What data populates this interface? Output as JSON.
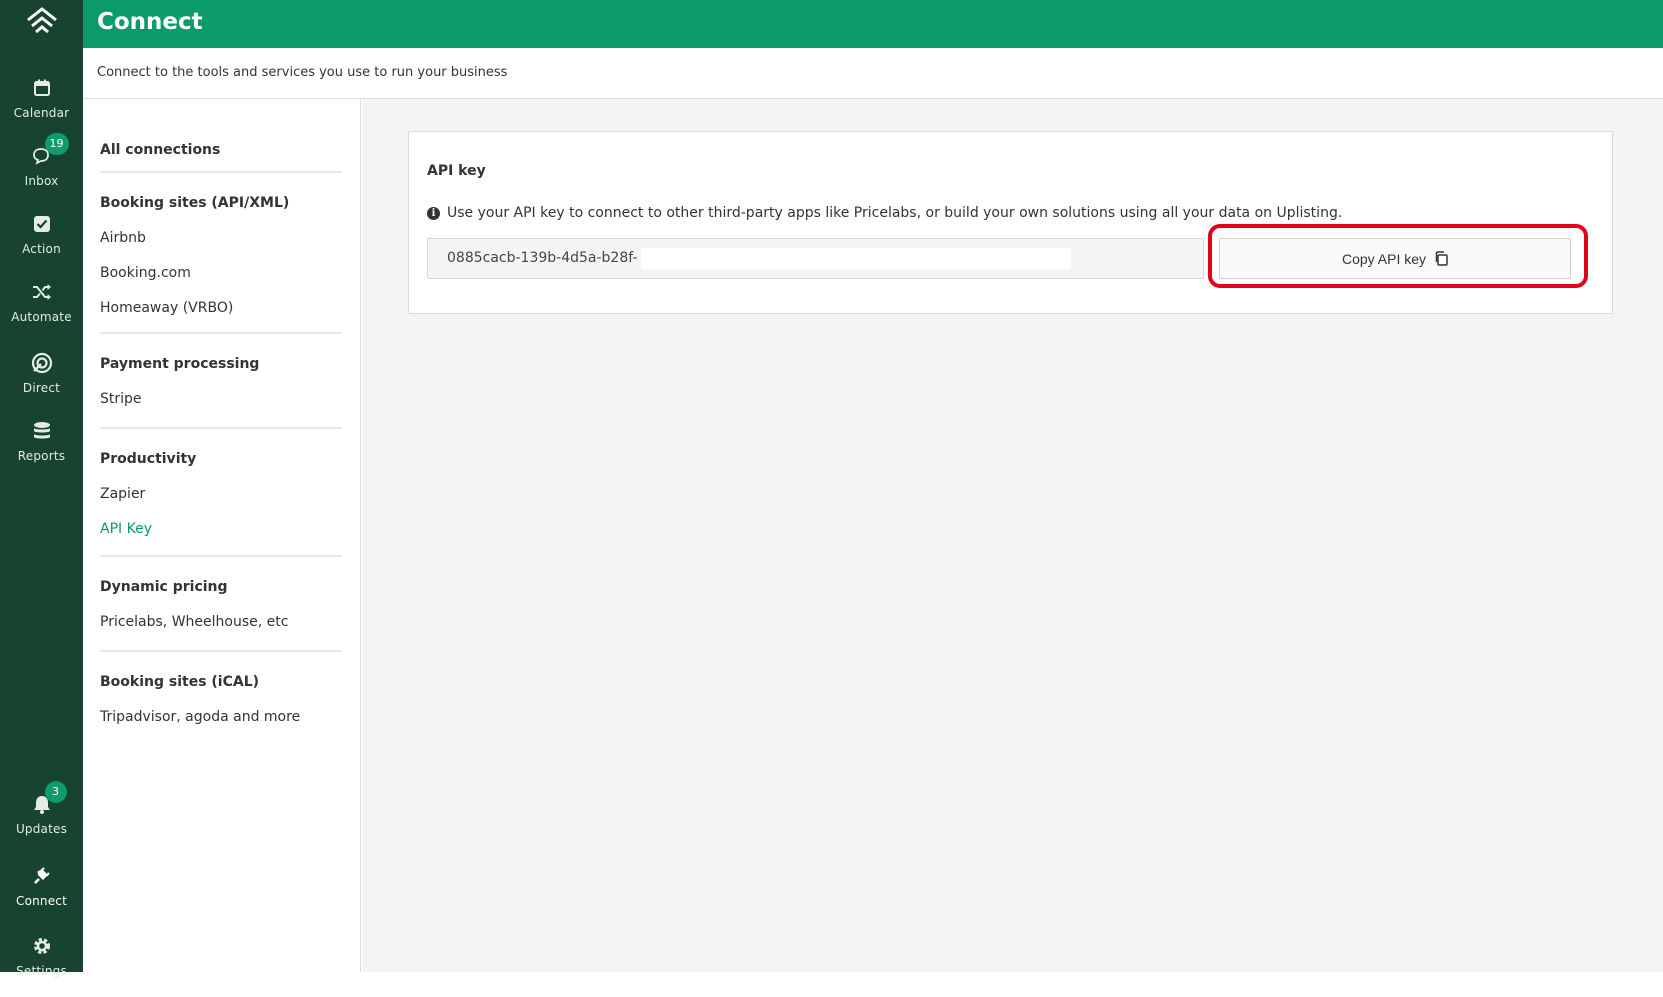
{
  "header": {
    "title": "Connect",
    "subtitle": "Connect to the tools and services you use to run your business"
  },
  "rail": {
    "items": [
      {
        "label": "Calendar",
        "icon": "calendar-icon"
      },
      {
        "label": "Inbox",
        "icon": "chat-icon",
        "badge": "19"
      },
      {
        "label": "Action",
        "icon": "checkbox-icon"
      },
      {
        "label": "Automate",
        "icon": "shuffle-icon"
      },
      {
        "label": "Direct",
        "icon": "direct-icon"
      },
      {
        "label": "Reports",
        "icon": "database-icon"
      },
      {
        "label": "Updates",
        "icon": "bell-icon",
        "badge": "3"
      },
      {
        "label": "Connect",
        "icon": "plug-icon",
        "active": true
      },
      {
        "label": "Settings",
        "icon": "gear-icon"
      }
    ]
  },
  "nav": {
    "all_connections": "All connections",
    "groups": [
      {
        "title": "Booking sites (API/XML)",
        "items": [
          "Airbnb",
          "Booking.com",
          "Homeaway (VRBO)"
        ]
      },
      {
        "title": "Payment processing",
        "items": [
          "Stripe"
        ]
      },
      {
        "title": "Productivity",
        "items": [
          "Zapier",
          "API Key"
        ],
        "active_item": "API Key"
      },
      {
        "title": "Dynamic pricing",
        "items": [
          "Pricelabs, Wheelhouse, etc"
        ]
      },
      {
        "title": "Booking sites (iCAL)",
        "items": [
          "Tripadvisor, agoda and more"
        ]
      }
    ]
  },
  "api_card": {
    "title": "API key",
    "help_text": "Use your API key to connect to other third-party apps like Pricelabs, or build your own solutions using all your data on Uplisting.",
    "key_value": "0885cacb-139b-4d5a-b28f-",
    "copy_label": "Copy API key"
  },
  "colors": {
    "brand_green": "#0b9b6a",
    "rail_bg": "#17432f",
    "highlight": "#e3001b"
  }
}
